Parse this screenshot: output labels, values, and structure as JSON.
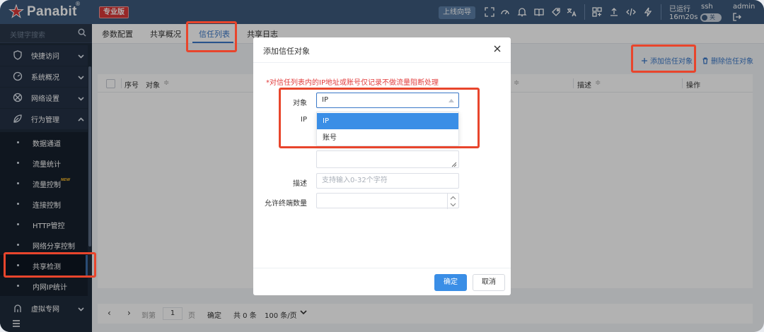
{
  "brand": {
    "name": "Panabit",
    "reg": "®",
    "edition": "专业版"
  },
  "topbar": {
    "guide_label": "上线向导",
    "icons": [
      "fullscreen-icon",
      "dashboard-icon",
      "bell-icon",
      "book-icon",
      "tag-icon",
      "translate-icon",
      "layout-icon",
      "upload-icon",
      "code-icon",
      "bolt-icon"
    ],
    "uptime_label": "已运行",
    "uptime_value": "16m20s",
    "ssh_label": "ssh",
    "ssh_toggle": "关",
    "user": "admin"
  },
  "sidebar": {
    "search_placeholder": "关键字搜索",
    "groups": [
      {
        "label": "快捷访问",
        "icon": "shield-icon"
      },
      {
        "label": "系统概况",
        "icon": "gauge-icon"
      },
      {
        "label": "网络设置",
        "icon": "network-icon"
      },
      {
        "label": "行为管理",
        "icon": "leaf-icon"
      }
    ],
    "sub_items": [
      {
        "label": "数据通道"
      },
      {
        "label": "流量统计"
      },
      {
        "label": "流量控制",
        "badge": "NEW"
      },
      {
        "label": "连接控制"
      },
      {
        "label": "HTTP管控"
      },
      {
        "label": "网络分享控制"
      },
      {
        "label": "共享检测",
        "active": true
      },
      {
        "label": "内网IP统计"
      }
    ],
    "bottom_group": {
      "label": "虚拟专网",
      "icon": "vpn-icon"
    }
  },
  "tabs": [
    {
      "label": "参数配置"
    },
    {
      "label": "共享概况"
    },
    {
      "label": "信任列表",
      "active": true
    },
    {
      "label": "共享日志"
    }
  ],
  "actions": {
    "add": "添加信任对象",
    "delete": "删除信任对象"
  },
  "table": {
    "columns": [
      "序号",
      "对象",
      "描述",
      "操作"
    ]
  },
  "pager": {
    "goto": "到第",
    "page": "1",
    "page_unit": "页",
    "confirm": "确定",
    "total": "共 0 条",
    "page_size": "100 条/页"
  },
  "dialog": {
    "title": "添加信任对象",
    "note": "*对信任列表内的IP地址或账号仅记录不做流量阻断处理",
    "object_label": "对象",
    "object_value": "IP",
    "options": [
      "IP",
      "账号"
    ],
    "ip_label": "IP",
    "desc_label": "描述",
    "desc_placeholder": "支持输入0-32个字符",
    "terminals_label": "允许终端数量",
    "ok": "确定",
    "cancel": "取消"
  },
  "colors": {
    "topbar": "#3d5a7c",
    "sidebar": "#1f2b3b",
    "accent": "#3a78c8",
    "highlight": "#e8452c",
    "note": "#e23c3c"
  }
}
